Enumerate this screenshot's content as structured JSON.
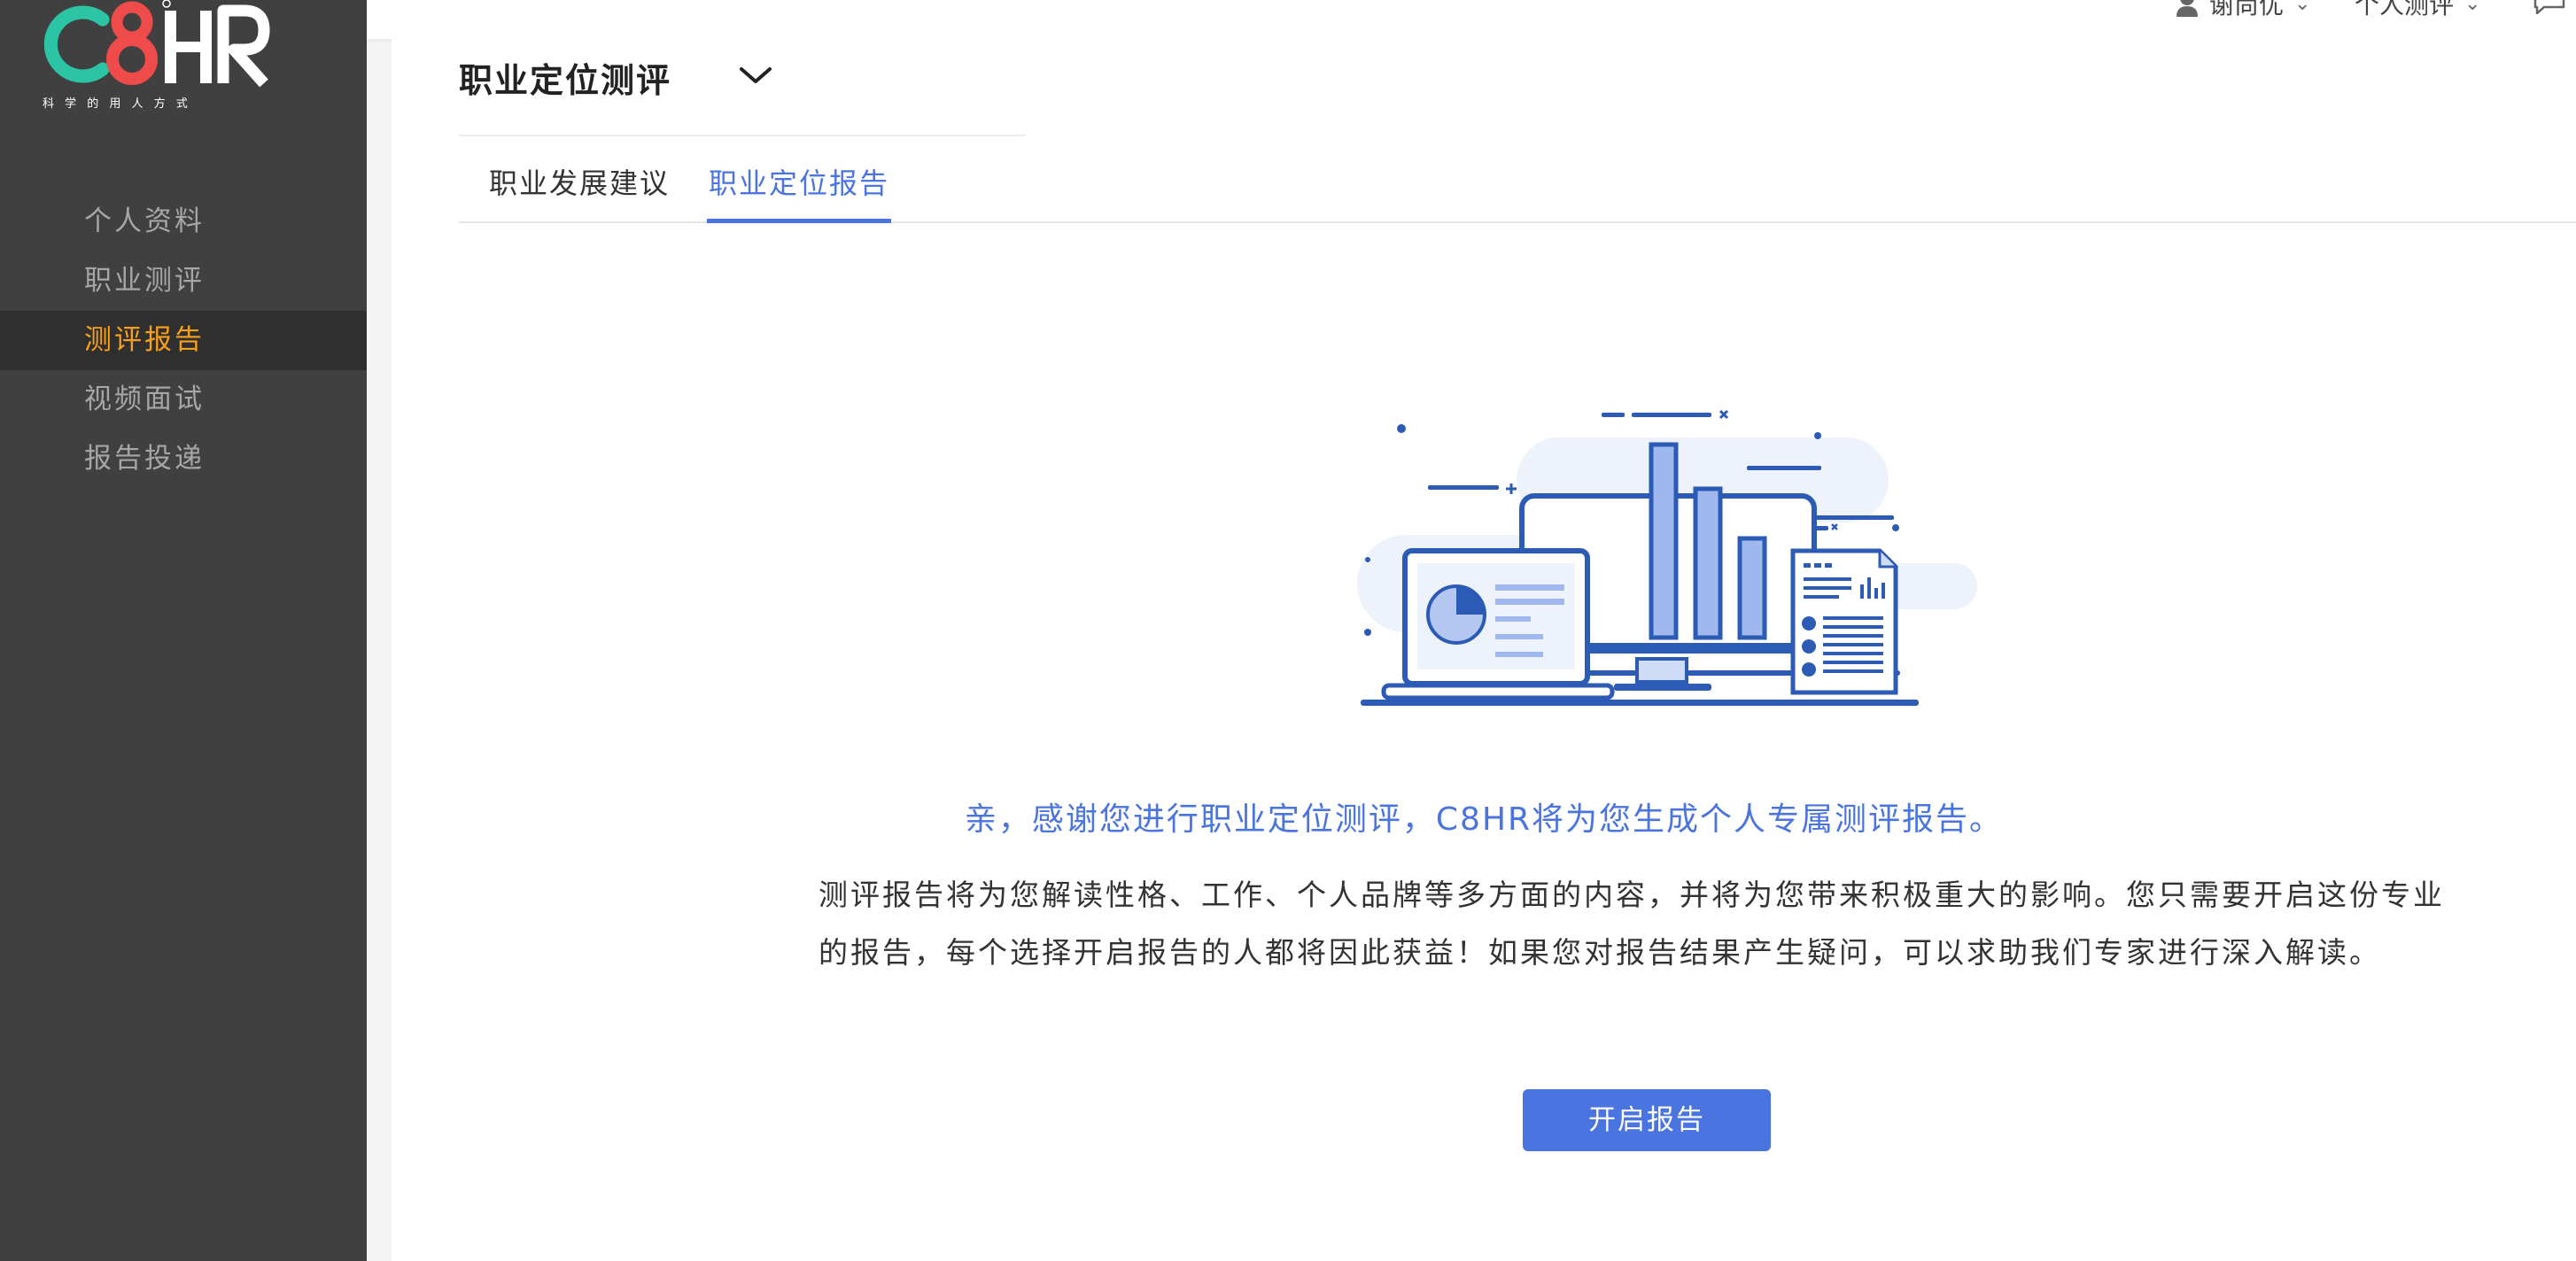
{
  "brand": {
    "logo_text": "C8HR",
    "tagline": "科 学 的 用 人 方 式",
    "colors": {
      "c": "#2bc4a4",
      "eight": "#f04b4b",
      "hr": "#ffffff",
      "accent": "#4a74e0",
      "nav_active": "#f7a01b"
    }
  },
  "topbar": {
    "user_name": "谢尚优",
    "menu2_label": "个人测评",
    "icons": {
      "user": "user-icon",
      "dropdown": "chevron-down-icon",
      "message": "message-icon"
    }
  },
  "sidebar": {
    "items": [
      {
        "label": "个人资料",
        "active": false
      },
      {
        "label": "职业测评",
        "active": false
      },
      {
        "label": "测评报告",
        "active": true
      },
      {
        "label": "视频面试",
        "active": false
      },
      {
        "label": "报告投递",
        "active": false
      }
    ]
  },
  "page": {
    "title": "职业定位测评",
    "tabs": [
      {
        "label": "职业发展建议",
        "active": false
      },
      {
        "label": "职业定位报告",
        "active": true
      }
    ],
    "headline": "亲，感谢您进行职业定位测评，C8HR将为您生成个人专属测评报告。",
    "description": "测评报告将为您解读性格、工作、个人品牌等多方面的内容，并将为您带来积极重大的影响。您只需要开启这份专业的报告，每个选择开启报告的人都将因此获益！如果您对报告结果产生疑问，可以求助我们专家进行深入解读。",
    "button_label": "开启报告"
  }
}
